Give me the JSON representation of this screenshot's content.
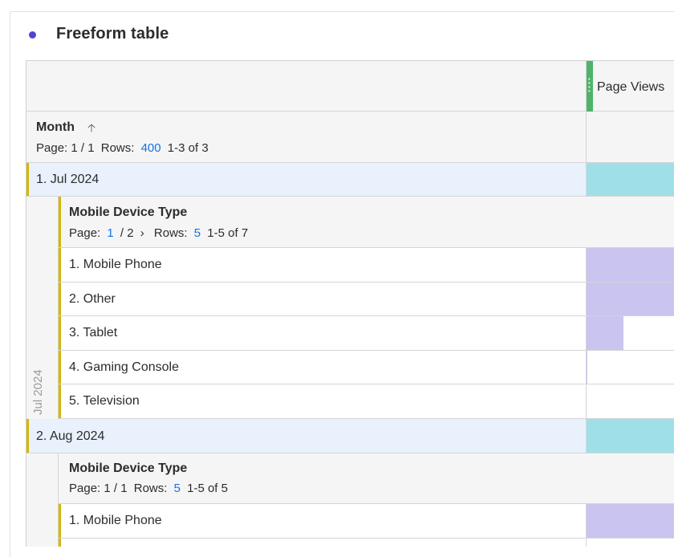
{
  "panel": {
    "title": "Freeform table"
  },
  "table": {
    "metric_label": "Page Views",
    "dimension": {
      "title": "Month",
      "pager": {
        "page_label": "Page: 1 / 1",
        "rows_label": "Rows:",
        "rows_value": "400",
        "range": "1-3 of 3"
      }
    },
    "months": [
      {
        "label": "1.  Jul 2024",
        "vertical_label": "Jul 2024",
        "bar_fill": 1.0,
        "breakdown": {
          "title": "Mobile Device Type",
          "pager": {
            "page_prefix": "Page:",
            "page_current": "1",
            "page_total": "/ 2",
            "next_icon": "chevron-right-icon",
            "rows_label": "Rows:",
            "rows_value": "5",
            "range": "1-5 of 7"
          },
          "items": [
            {
              "label": "1.  Mobile Phone",
              "bar_fill": 1.0
            },
            {
              "label": "2.  Other",
              "bar_fill": 1.0
            },
            {
              "label": "3.  Tablet",
              "bar_fill": 0.42
            },
            {
              "label": "4.  Gaming Console",
              "bar_fill": 0.01
            },
            {
              "label": "5.  Television",
              "bar_fill": 0.0
            }
          ]
        }
      },
      {
        "label": "2.  Aug 2024",
        "bar_fill": 1.0,
        "breakdown": {
          "title": "Mobile Device Type",
          "pager": {
            "page_label": "Page: 1 / 1",
            "rows_label": "Rows:",
            "rows_value": "5",
            "range": "1-5 of 5"
          },
          "items": [
            {
              "label": "1.  Mobile Phone",
              "bar_fill": 1.0
            }
          ]
        }
      }
    ]
  },
  "colors": {
    "accent_dot": "#5144d3",
    "metric_grip": "#4fb36a",
    "month_bar": "#9fe0e8",
    "item_bar": "#c9c4f0",
    "link": "#1473e6",
    "row_marker": "#d4b600"
  }
}
